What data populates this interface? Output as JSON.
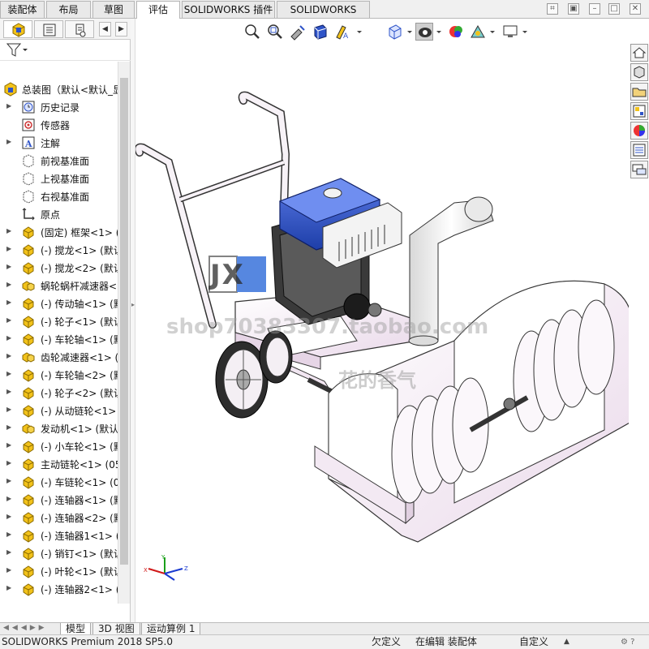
{
  "tabs": [
    {
      "label": "装配体",
      "active": false
    },
    {
      "label": "布局",
      "active": false
    },
    {
      "label": "草图",
      "active": false
    },
    {
      "label": "评估",
      "active": true
    },
    {
      "label": "SOLIDWORKS 插件",
      "active": false
    },
    {
      "label": "SOLIDWORKS MBD",
      "active": false
    }
  ],
  "tree": {
    "root": "总装图（默认<默认_显",
    "items": [
      {
        "label": "历史记录",
        "icon": "history-icon",
        "expand": true
      },
      {
        "label": "传感器",
        "icon": "sensor-icon",
        "expand": false
      },
      {
        "label": "注解",
        "icon": "annotation-icon",
        "expand": true
      },
      {
        "label": "前视基准面",
        "icon": "plane-icon",
        "expand": false
      },
      {
        "label": "上视基准面",
        "icon": "plane-icon",
        "expand": false
      },
      {
        "label": "右视基准面",
        "icon": "plane-icon",
        "expand": false
      },
      {
        "label": "原点",
        "icon": "origin-icon",
        "expand": false
      },
      {
        "label": "(固定) 框架<1> (",
        "icon": "part-icon",
        "expand": true
      },
      {
        "label": "(-) 搅龙<1> (默认",
        "icon": "part-icon",
        "expand": true
      },
      {
        "label": "(-) 搅龙<2> (默认",
        "icon": "part-icon",
        "expand": true
      },
      {
        "label": "蜗轮蜗杆减速器<",
        "icon": "subassembly-icon",
        "expand": true
      },
      {
        "label": "(-) 传动轴<1> (默",
        "icon": "part-icon",
        "expand": true
      },
      {
        "label": "(-) 轮子<1> (默认",
        "icon": "part-icon",
        "expand": true
      },
      {
        "label": "(-) 车轮轴<1> (默",
        "icon": "part-icon",
        "expand": true
      },
      {
        "label": "齿轮减速器<1> (",
        "icon": "subassembly-icon",
        "expand": true
      },
      {
        "label": "(-) 车轮轴<2> (默",
        "icon": "part-icon",
        "expand": true
      },
      {
        "label": "(-) 轮子<2> (默认",
        "icon": "part-icon",
        "expand": true
      },
      {
        "label": "(-) 从动链轮<1> (",
        "icon": "part-icon",
        "expand": true
      },
      {
        "label": "发动机<1> (默认",
        "icon": "subassembly-icon",
        "expand": true
      },
      {
        "label": "(-) 小车轮<1> (默",
        "icon": "part-icon",
        "expand": true
      },
      {
        "label": "主动链轮<1> (05",
        "icon": "part-icon",
        "expand": true
      },
      {
        "label": "(-) 车链轮<1> (0",
        "icon": "part-icon",
        "expand": true
      },
      {
        "label": "(-) 连轴器<1> (默",
        "icon": "part-icon",
        "expand": true
      },
      {
        "label": "(-) 连轴器<2> (默",
        "icon": "part-icon",
        "expand": true
      },
      {
        "label": "(-) 连轴器1<1> (",
        "icon": "part-icon",
        "expand": true
      },
      {
        "label": "(-) 销钉<1> (默认",
        "icon": "part-icon",
        "expand": true
      },
      {
        "label": "(-) 叶轮<1> (默认",
        "icon": "part-icon",
        "expand": true
      },
      {
        "label": "(-) 连轴器2<1> (",
        "icon": "part-icon",
        "expand": true
      }
    ]
  },
  "watermark": {
    "logo": "JX",
    "line1": "shop70383307.taobao.com",
    "line2": "花的香气"
  },
  "bottom_tabs": [
    "模型",
    "3D 视图",
    "运动算例 1"
  ],
  "status": {
    "product": "SOLIDWORKS Premium 2018 SP5.0",
    "definition": "欠定义",
    "editing": "在编辑 装配体",
    "units": "自定义"
  },
  "colors": {
    "accent_blue": "#2f54c8",
    "part_yellow": "#e8b400",
    "body_pink": "#f6eef6"
  }
}
